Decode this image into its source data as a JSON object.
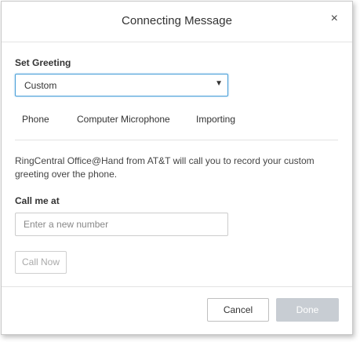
{
  "dialog": {
    "title": "Connecting Message",
    "close_icon": "×"
  },
  "greeting": {
    "label": "Set Greeting",
    "selected": "Custom",
    "arrow": "▼"
  },
  "tabs": [
    {
      "label": "Phone",
      "active": true
    },
    {
      "label": "Computer Microphone",
      "active": false
    },
    {
      "label": "Importing",
      "active": false
    }
  ],
  "phone": {
    "description": "RingCentral Office@Hand from AT&T will call you to record your custom greeting over the phone.",
    "call_label": "Call me at",
    "number_placeholder": "Enter a new number",
    "call_now": "Call Now"
  },
  "footer": {
    "cancel": "Cancel",
    "done": "Done"
  },
  "colors": {
    "focus_border": "#4a9fd8",
    "done_disabled": "#c8cdd3"
  }
}
